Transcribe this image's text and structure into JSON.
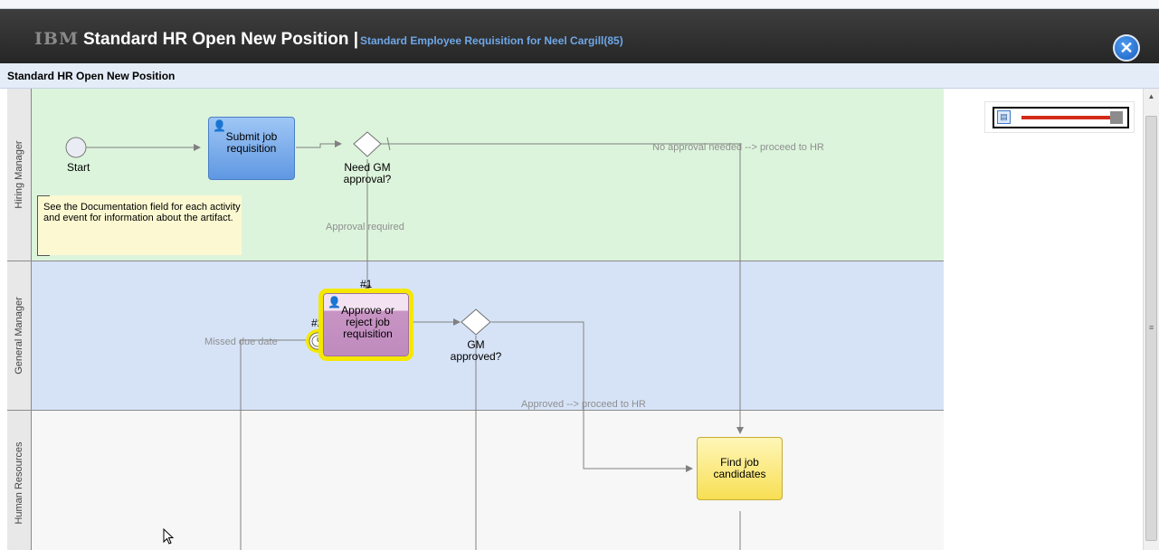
{
  "window": {
    "brand": "IBM",
    "title": "Standard HR Open New Position |",
    "subtitle": "Standard Employee Requisition for Neel Cargill(85)",
    "close_icon": "close-icon"
  },
  "section": {
    "title": "Standard HR Open New Position"
  },
  "lanes": [
    {
      "label": "Hiring Manager",
      "color": "#dcf4dc"
    },
    {
      "label": "General Manager",
      "color": "#d6e3f7"
    },
    {
      "label": "Human Resources",
      "color": "#f7f7f7"
    }
  ],
  "nodes": {
    "start_label": "Start",
    "submit": "Submit job requisition",
    "need_gm": "Need GM approval?",
    "approve": "Approve or reject job requisition",
    "gm_approved": "GM approved?",
    "find": "Find job candidates",
    "marker_1": "#1",
    "marker_2": "#2"
  },
  "flow_labels": {
    "no_approval": "No approval needed --> proceed to HR",
    "approval_required": "Approval required",
    "missed_due": "Missed due date",
    "approved": "Approved --> proceed to HR"
  },
  "note": "See the Documentation field for each activity and event for information about the artifact.",
  "overview": {
    "icon": "print-icon",
    "accent": "#d42a18"
  },
  "scrollbar": {
    "up_icon": "▲",
    "grip_icon": "≡"
  }
}
